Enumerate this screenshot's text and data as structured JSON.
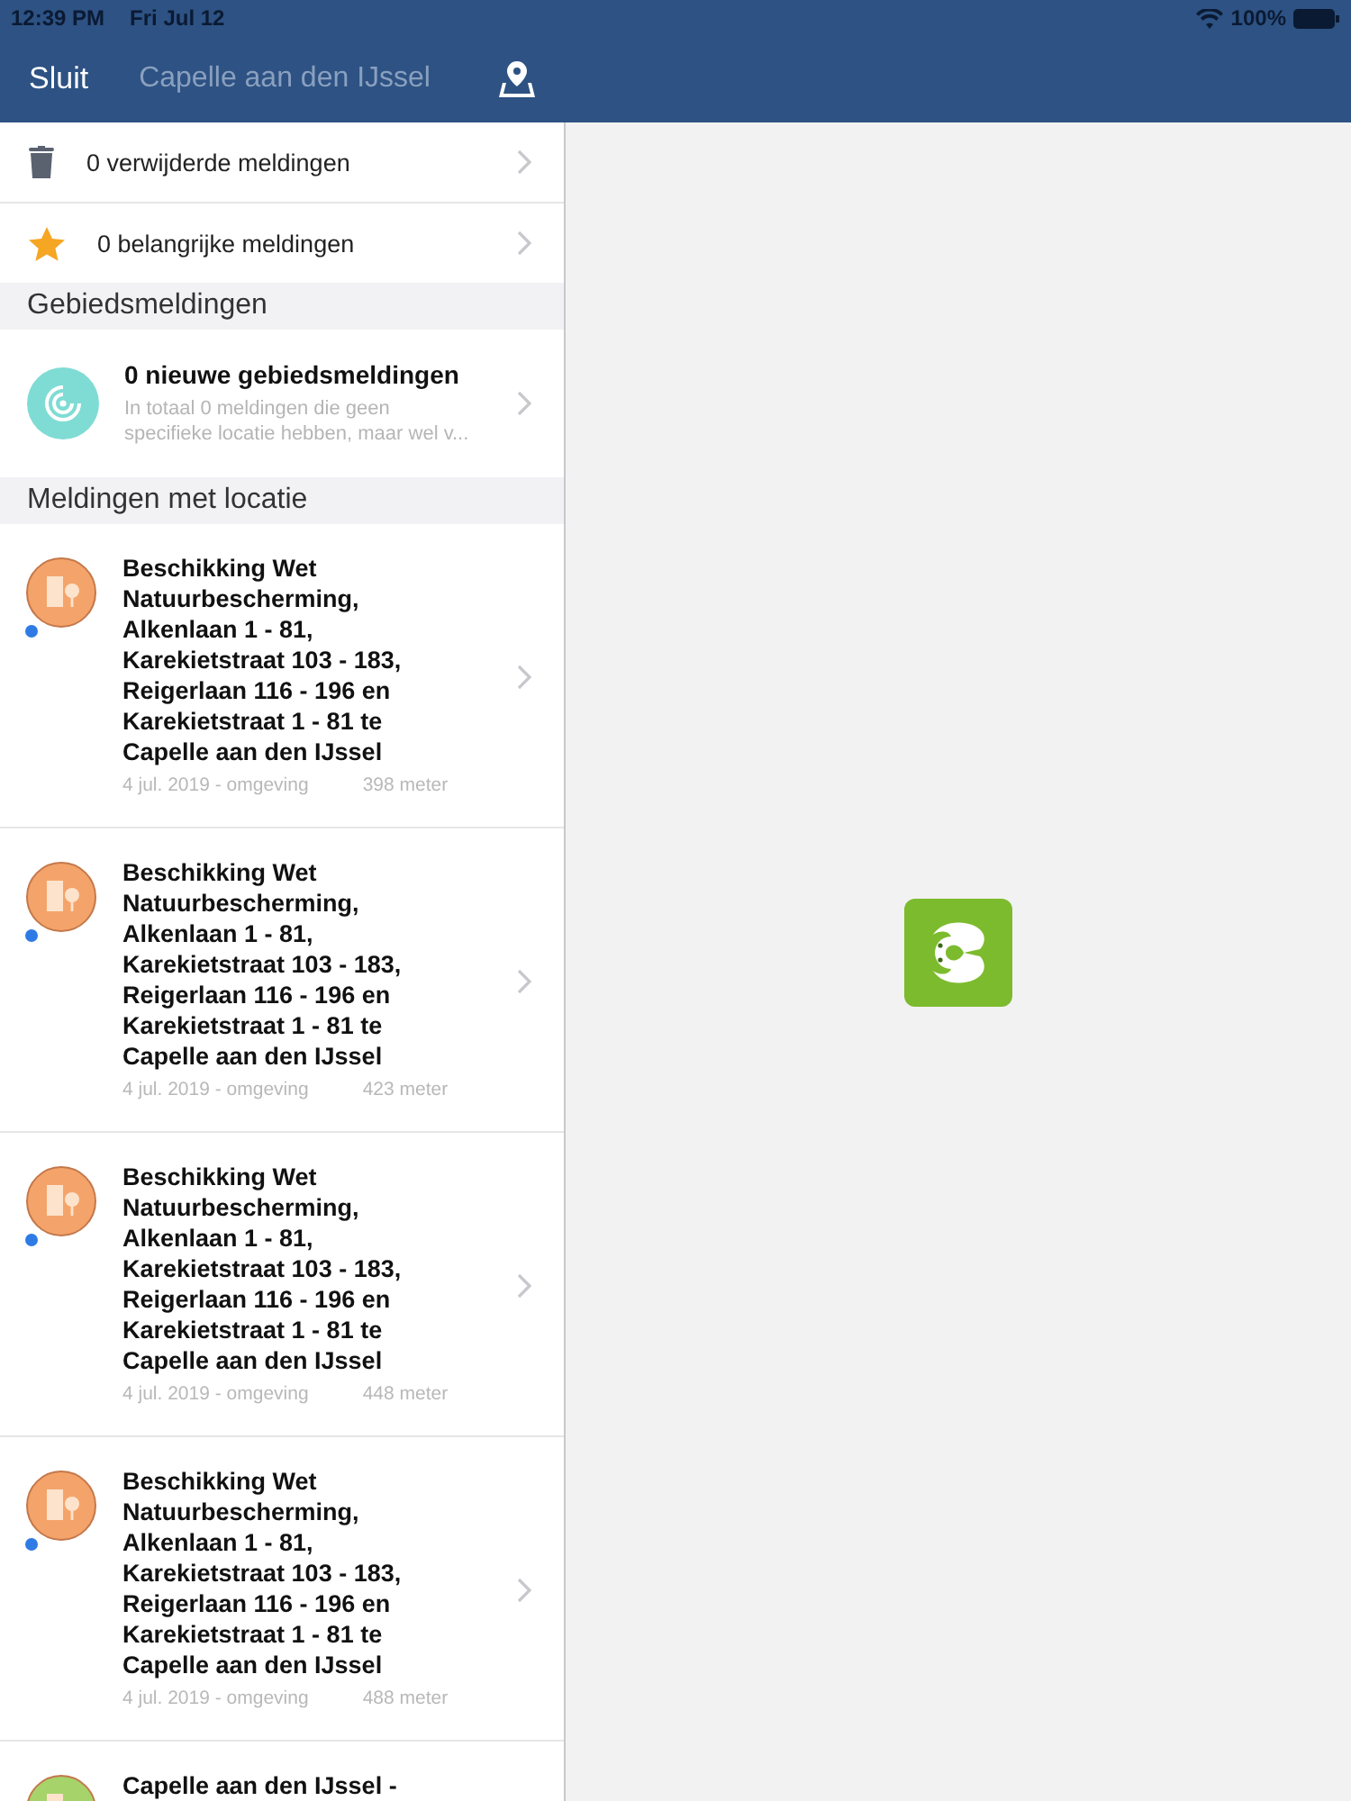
{
  "status_bar": {
    "time": "12:39 PM",
    "date": "Fri Jul 12",
    "battery": "100%"
  },
  "nav": {
    "close": "Sluit",
    "title": "Capelle aan den IJssel"
  },
  "quick_items": [
    {
      "kind": "trash",
      "label": "0 verwijderde meldingen"
    },
    {
      "kind": "star",
      "label": "0 belangrijke meldingen"
    }
  ],
  "area_section": {
    "header": "Gebiedsmeldingen",
    "title": "0 nieuwe gebiedsmeldingen",
    "subtitle": "In totaal 0 meldingen die geen\nspecifieke locatie hebben, maar wel v..."
  },
  "location_section": {
    "header": "Meldingen met locatie",
    "items": [
      {
        "title": "Beschikking Wet\nNatuurbescherming,\nAlkenlaan 1 - 81,\nKarekietstraat 103 - 183,\nReigerlaan 116 - 196 en\nKarekietstraat 1 - 81 te\nCapelle aan den IJssel",
        "meta": "4 jul. 2019 - omgeving",
        "distance": "398 meter",
        "unread": true,
        "color": "#f4a46a"
      },
      {
        "title": "Beschikking Wet\nNatuurbescherming,\nAlkenlaan 1 - 81,\nKarekietstraat 103 - 183,\nReigerlaan 116 - 196 en\nKarekietstraat 1 - 81 te\nCapelle aan den IJssel",
        "meta": "4 jul. 2019 - omgeving",
        "distance": "423 meter",
        "unread": true,
        "color": "#f4a46a"
      },
      {
        "title": "Beschikking Wet\nNatuurbescherming,\nAlkenlaan 1 - 81,\nKarekietstraat 103 - 183,\nReigerlaan 116 - 196 en\nKarekietstraat 1 - 81 te\nCapelle aan den IJssel",
        "meta": "4 jul. 2019 - omgeving",
        "distance": "448 meter",
        "unread": true,
        "color": "#f4a46a"
      },
      {
        "title": "Beschikking Wet\nNatuurbescherming,\nAlkenlaan 1 - 81,\nKarekietstraat 103 - 183,\nReigerlaan 116 - 196 en\nKarekietstraat 1 - 81 te\nCapelle aan den IJssel",
        "meta": "4 jul. 2019 - omgeving",
        "distance": "488 meter",
        "unread": true,
        "color": "#f4a46a"
      },
      {
        "title": "Capelle aan den IJssel -",
        "color": "#a6d36a"
      }
    ]
  }
}
